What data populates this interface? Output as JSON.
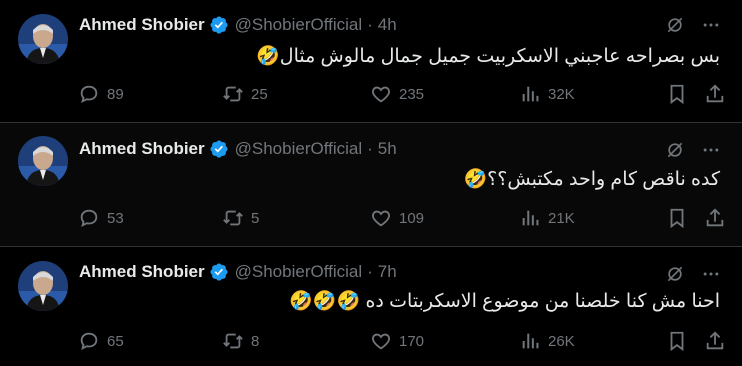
{
  "tweets": [
    {
      "name": "Ahmed Shobier",
      "handle": "@ShobierOfficial",
      "separator": "·",
      "time": "4h",
      "text": "بس بصراحه عاجبني الاسكربيت جميل جمال مالوش مثال🤣",
      "replies": "89",
      "retweets": "25",
      "likes": "235",
      "views": "32K"
    },
    {
      "name": "Ahmed Shobier",
      "handle": "@ShobierOfficial",
      "separator": "·",
      "time": "5h",
      "text": "كده ناقص كام واحد مكتبش؟؟🤣",
      "replies": "53",
      "retweets": "5",
      "likes": "109",
      "views": "21K"
    },
    {
      "name": "Ahmed Shobier",
      "handle": "@ShobierOfficial",
      "separator": "·",
      "time": "7h",
      "text": "احنا مش كنا خلصنا من موضوع الاسكربتات ده 🤣🤣🤣",
      "replies": "65",
      "retweets": "8",
      "likes": "170",
      "views": "26K"
    }
  ],
  "icons": {
    "verified": "verified-badge-icon",
    "grok": "grok-icon",
    "more": "more-icon",
    "reply": "reply-icon",
    "retweet": "retweet-icon",
    "like": "heart-icon",
    "views": "views-icon",
    "bookmark": "bookmark-icon",
    "share": "share-icon"
  },
  "colors": {
    "background": "#000000",
    "text": "#e7e9ea",
    "muted": "#71767b",
    "verified": "#1d9bf0",
    "divider": "#2f3336"
  }
}
